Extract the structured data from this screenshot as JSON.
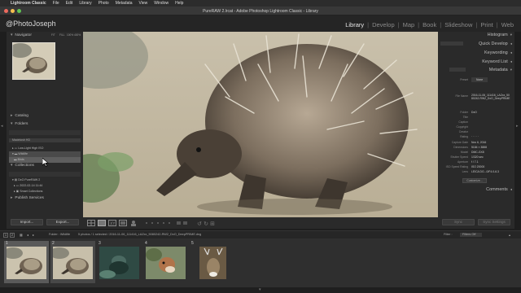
{
  "menubar": {
    "app_name": "Lightroom Classic",
    "items": [
      "File",
      "Edit",
      "Library",
      "Photo",
      "Metadata",
      "View",
      "Window",
      "Help"
    ]
  },
  "window": {
    "title": "PureRAW 2.lrcat - Adobe Photoshop Lightroom Classic - Library"
  },
  "identity_plate": "@PhotoJoseph",
  "modules": [
    {
      "label": "Library",
      "active": true
    },
    {
      "label": "Develop",
      "active": false
    },
    {
      "label": "Map",
      "active": false
    },
    {
      "label": "Book",
      "active": false
    },
    {
      "label": "Slideshow",
      "active": false
    },
    {
      "label": "Print",
      "active": false
    },
    {
      "label": "Web",
      "active": false
    }
  ],
  "left_panel": {
    "navigator": {
      "label": "Navigator",
      "modes": [
        "FIT",
        "FILL",
        "100%",
        "400%"
      ]
    },
    "catalog": {
      "label": "Catalog"
    },
    "folders": {
      "label": "Folders",
      "volume": "Macintosh HD",
      "items": [
        {
          "name": "Low-Light High ISO",
          "count": ""
        },
        {
          "name": "Wildlife",
          "count": ""
        },
        {
          "name": "Birds",
          "count": ""
        }
      ]
    },
    "collections": {
      "label": "Collections",
      "items": [
        {
          "name": "DxO PureRAW 2"
        },
        {
          "name": "2022-02-14 11:44"
        },
        {
          "name": "Smart Collections"
        }
      ]
    },
    "publish": {
      "label": "Publish Services"
    },
    "import_label": "Import...",
    "export_label": "Export..."
  },
  "right_panel": {
    "headers": [
      "Histogram",
      "Quick Develop",
      "Keywording",
      "Keyword List",
      "Metadata",
      "Comments"
    ],
    "metadata_preset": {
      "label": "Preset",
      "value": "None"
    },
    "metadata_rows": [
      {
        "label": "File Name",
        "value": "2016-11-06_111416_LAZxx_5080242-RW2_DxO_DeepPRIME"
      },
      {
        "label": "Folder",
        "value": "DxO"
      },
      {
        "label": "Title",
        "value": ""
      },
      {
        "label": "Caption",
        "value": ""
      },
      {
        "label": "Copyright",
        "value": ""
      },
      {
        "label": "Creator",
        "value": ""
      },
      {
        "label": "Rating",
        "value": "· · · · ·"
      },
      {
        "label": "Capture Date",
        "value": "Nov 6, 2016"
      },
      {
        "label": "Dimensions",
        "value": "5184 × 3888"
      },
      {
        "label": "Model",
        "value": "DMC-GX8"
      },
      {
        "label": "Shutter Speed",
        "value": "1/320 sec"
      },
      {
        "label": "Aperture",
        "value": "f / 7.1"
      },
      {
        "label": "ISO Speed Rating",
        "value": "ISO 20000"
      },
      {
        "label": "Lens",
        "value": "LEICA DG...0/F4.0-6.3"
      }
    ],
    "customize_label": "Customize...",
    "sync_label": "Sync",
    "sync_settings_label": "Sync Settings"
  },
  "secondary_bar": {
    "pages": [
      "1",
      "2"
    ],
    "source": "Folder : Wildlife",
    "status": "5 photos / 1 selected / 2016-11-06_111416_LAZxx_5080242-RW2_DxO_DeepPRIME.dng",
    "filter_label": "Filter :",
    "filter_value": "Filters Off"
  },
  "filmstrip": [
    {
      "number": "1"
    },
    {
      "number": "2"
    },
    {
      "number": "3"
    },
    {
      "number": "4"
    },
    {
      "number": "5"
    }
  ]
}
